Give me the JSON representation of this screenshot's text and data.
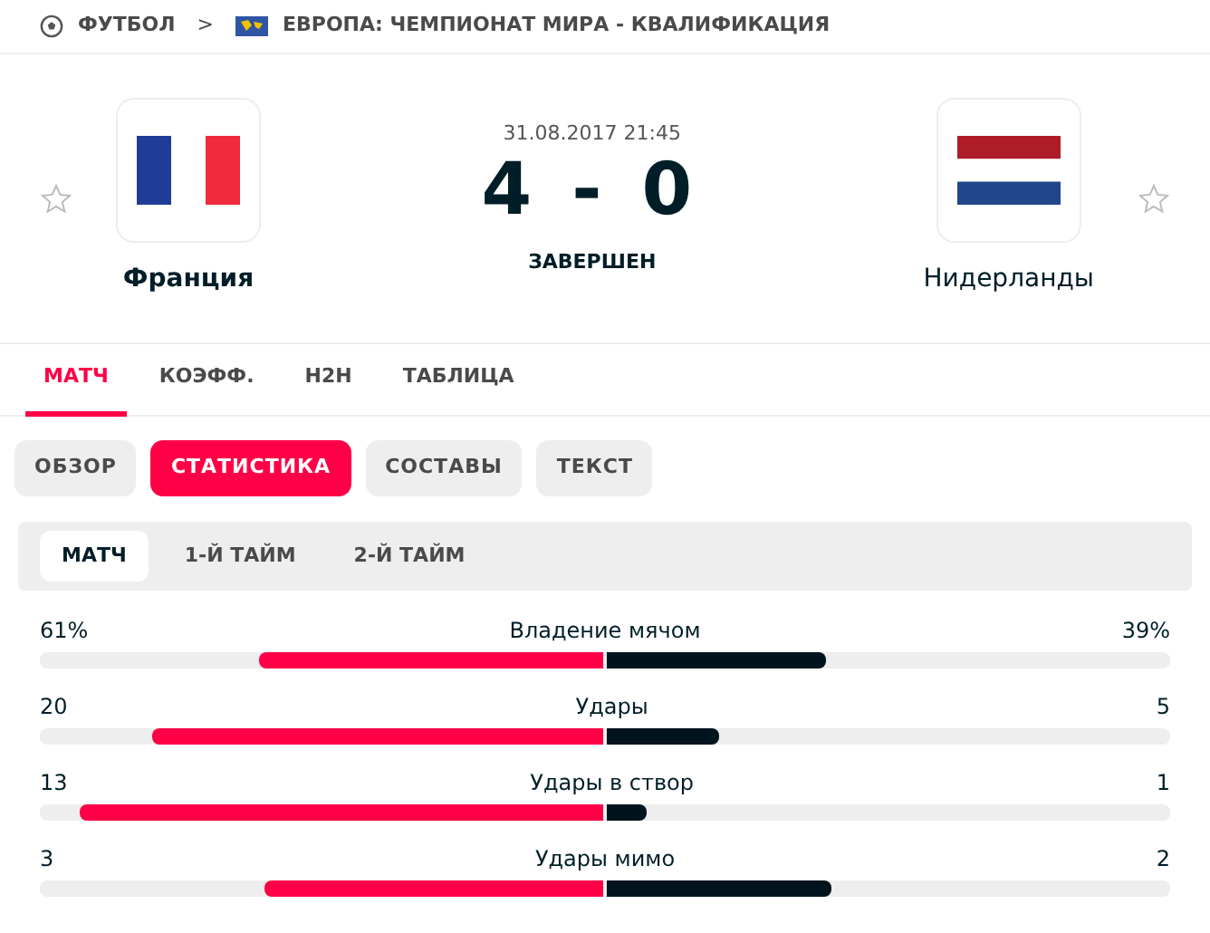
{
  "breadcrumb": {
    "sport": "ФУТБОЛ",
    "separator": ">",
    "competition": "ЕВРОПА: ЧЕМПИОНАТ МИРА - КВАЛИФИКАЦИЯ"
  },
  "match": {
    "datetime": "31.08.2017 21:45",
    "score_home": "4",
    "score_separator": "-",
    "score_away": "0",
    "status": "ЗАВЕРШЕН",
    "home": {
      "name": "Франция",
      "favorite": false,
      "winner": true
    },
    "away": {
      "name": "Нидерланды",
      "favorite": false,
      "winner": false
    }
  },
  "tabs": [
    {
      "label": "МАТЧ",
      "selected": true
    },
    {
      "label": "КОЭФФ.",
      "selected": false
    },
    {
      "label": "H2H",
      "selected": false
    },
    {
      "label": "ТАБЛИЦА",
      "selected": false
    }
  ],
  "pills": [
    {
      "label": "ОБЗОР",
      "selected": false
    },
    {
      "label": "СТАТИСТИКА",
      "selected": true
    },
    {
      "label": "СОСТАВЫ",
      "selected": false
    },
    {
      "label": "ТЕКСТ",
      "selected": false
    }
  ],
  "periods": [
    {
      "label": "МАТЧ",
      "selected": true
    },
    {
      "label": "1-Й ТАЙМ",
      "selected": false
    },
    {
      "label": "2-Й ТАЙМ",
      "selected": false
    }
  ],
  "stats": [
    {
      "name": "Владение мячом",
      "home": {
        "value": "61%"
      },
      "away": {
        "value": "39%"
      }
    },
    {
      "name": "Удары",
      "home": {
        "value": "20"
      },
      "away": {
        "value": "5"
      }
    },
    {
      "name": "Удары в створ",
      "home": {
        "value": "13"
      },
      "away": {
        "value": "1"
      }
    },
    {
      "name": "Удары мимо",
      "home": {
        "value": "3"
      },
      "away": {
        "value": "2"
      }
    }
  ]
}
